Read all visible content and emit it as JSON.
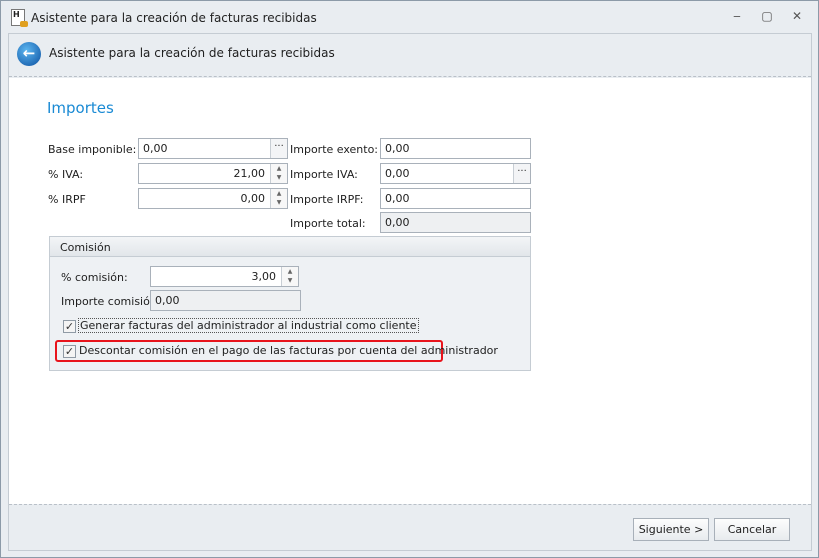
{
  "window": {
    "title": "Asistente para la creación de facturas recibidas",
    "minimize": "‒",
    "restore": "▢",
    "close": "✕"
  },
  "header": {
    "title": "Asistente para la creación de facturas recibidas"
  },
  "section": {
    "title": "Importes"
  },
  "fields": {
    "base_label": "Base imponible:",
    "base_value": "0,00",
    "iva_pct_label": "% IVA:",
    "iva_pct_value": "21,00",
    "irpf_pct_label": "% IRPF",
    "irpf_pct_value": "0,00",
    "exento_label": "Importe exento:",
    "exento_value": "0,00",
    "iva_amt_label": "Importe IVA:",
    "iva_amt_value": "0,00",
    "irpf_amt_label": "Importe IRPF:",
    "irpf_amt_value": "0,00",
    "total_label": "Importe total:",
    "total_value": "0,00",
    "ellipsis": "···"
  },
  "comision": {
    "title": "Comisión",
    "pct_label": "% comisión:",
    "pct_value": "3,00",
    "amt_label": "Importe comisión:",
    "amt_value": "0,00",
    "check1": "Generar facturas del administrador al industrial como cliente",
    "check2": "Descontar comisión en el pago de las facturas por cuenta del administrador",
    "check_mark": "✓"
  },
  "footer": {
    "next": "Siguiente >",
    "cancel": "Cancelar"
  },
  "colors": {
    "accent": "#1a8ad4",
    "highlight": "#e8141c"
  }
}
